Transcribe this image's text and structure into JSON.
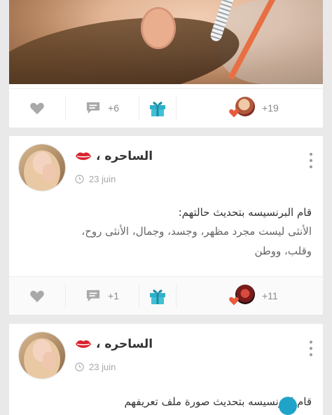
{
  "colors": {
    "background": "#e9e9e9",
    "card": "#ffffff",
    "heart_red": "#e85a3c",
    "gift_teal": "#2fb0c8"
  },
  "post1": {
    "comment_count": "+6",
    "reaction_count": "+19"
  },
  "post2": {
    "author": "الساحره ،",
    "author_badge_icon": "lips-icon",
    "date": "23 juin",
    "status_text": "قام البرنسيسه  بتحديث حالتهم:",
    "body_lines": [
      "الأنثى ليست مجرد مظهر، وجسد، وجمال، الأنثى روح،",
      "وقلب، ووطن"
    ],
    "comment_count": "+1",
    "reaction_count": "+11"
  },
  "post3": {
    "author": "الساحره ،",
    "author_badge_icon": "lips-icon",
    "date": "23 juin",
    "status_text": "قام البرنسيسه  بتحديث صورة ملف تعريفهم"
  }
}
